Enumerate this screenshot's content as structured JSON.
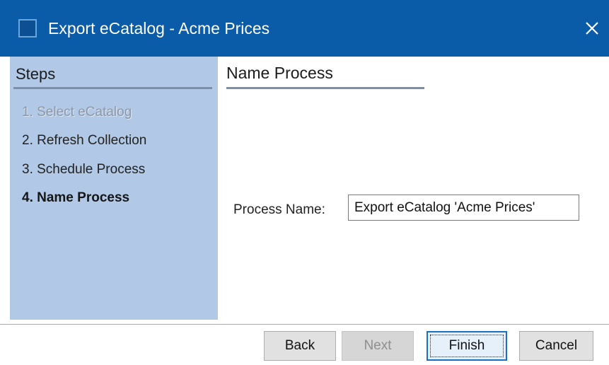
{
  "window": {
    "title": "Export eCatalog - Acme Prices",
    "titlebar_color": "#0a5ba8",
    "app_icon": "window-app-icon",
    "close_icon": "close-icon"
  },
  "steps": {
    "heading": "Steps",
    "panel_color": "#b1c8e6",
    "items": [
      {
        "label": "1. Select eCatalog",
        "state": "completed"
      },
      {
        "label": "2. Refresh Collection",
        "state": "pending"
      },
      {
        "label": "3. Schedule Process",
        "state": "pending"
      },
      {
        "label": "4. Name Process",
        "state": "current"
      }
    ]
  },
  "content": {
    "heading": "Name Process",
    "process_name": {
      "label": "Process Name:",
      "value": "Export eCatalog 'Acme Prices'"
    }
  },
  "buttons": {
    "back": "Back",
    "next": "Next",
    "finish": "Finish",
    "cancel": "Cancel"
  }
}
